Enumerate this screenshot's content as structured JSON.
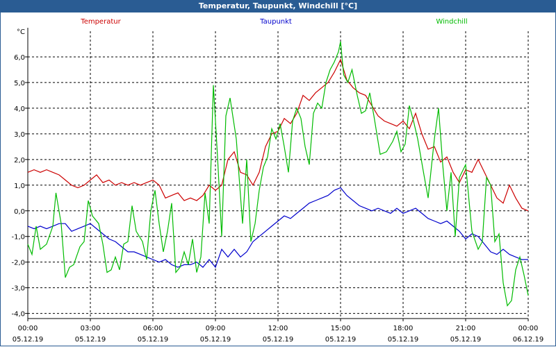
{
  "window": {
    "title": "Temperatur, Taupunkt, Windchill [°C]"
  },
  "colors": {
    "title_bar": "#2a5c93",
    "temperatur": "#cc0000",
    "taupunkt": "#0000cc",
    "windchill": "#00bb00",
    "grid": "#000000"
  },
  "chart_data": {
    "type": "line",
    "title": "Temperatur, Taupunkt, Windchill [°C]",
    "ylabel": "°C",
    "ylim": [
      -4.2,
      7.0
    ],
    "y_ticks": [
      -4.0,
      -3.0,
      -2.0,
      -1.0,
      0.0,
      1.0,
      2.0,
      3.0,
      4.0,
      5.0,
      6.0
    ],
    "y_tick_labels": [
      "-4,0",
      "-3,0",
      "-2,0",
      "-1,0",
      "0,0",
      "1,0",
      "2,0",
      "3,0",
      "4,0",
      "5,0",
      "6,0"
    ],
    "xlim": [
      0,
      24
    ],
    "x_ticks": [
      0,
      3,
      6,
      9,
      12,
      15,
      18,
      21,
      24
    ],
    "x_tick_times": [
      "00:00",
      "03:00",
      "06:00",
      "09:00",
      "12:00",
      "15:00",
      "18:00",
      "21:00",
      "00:00"
    ],
    "x_tick_dates": [
      "05.12.19",
      "05.12.19",
      "05.12.19",
      "05.12.19",
      "05.12.19",
      "05.12.19",
      "05.12.19",
      "05.12.19",
      "06.12.19"
    ],
    "grid": true,
    "legend_position": "top",
    "series": [
      {
        "name": "Temperatur",
        "color": "#cc0000",
        "points": [
          [
            0,
            1.5
          ],
          [
            0.3,
            1.6
          ],
          [
            0.6,
            1.5
          ],
          [
            0.9,
            1.6
          ],
          [
            1.2,
            1.5
          ],
          [
            1.5,
            1.4
          ],
          [
            1.8,
            1.2
          ],
          [
            2.1,
            1.0
          ],
          [
            2.4,
            0.9
          ],
          [
            2.7,
            1.0
          ],
          [
            3.0,
            1.2
          ],
          [
            3.3,
            1.4
          ],
          [
            3.6,
            1.1
          ],
          [
            3.9,
            1.2
          ],
          [
            4.2,
            1.0
          ],
          [
            4.5,
            1.1
          ],
          [
            4.8,
            1.0
          ],
          [
            5.1,
            1.1
          ],
          [
            5.4,
            1.0
          ],
          [
            5.7,
            1.1
          ],
          [
            6.0,
            1.2
          ],
          [
            6.3,
            1.0
          ],
          [
            6.6,
            0.5
          ],
          [
            6.9,
            0.6
          ],
          [
            7.2,
            0.7
          ],
          [
            7.5,
            0.4
          ],
          [
            7.8,
            0.5
          ],
          [
            8.1,
            0.4
          ],
          [
            8.4,
            0.6
          ],
          [
            8.7,
            1.0
          ],
          [
            9.0,
            0.8
          ],
          [
            9.3,
            1.0
          ],
          [
            9.6,
            2.0
          ],
          [
            9.9,
            2.3
          ],
          [
            10.2,
            1.5
          ],
          [
            10.5,
            1.4
          ],
          [
            10.8,
            1.0
          ],
          [
            11.1,
            1.5
          ],
          [
            11.4,
            2.5
          ],
          [
            11.7,
            3.0
          ],
          [
            12.0,
            3.1
          ],
          [
            12.3,
            3.6
          ],
          [
            12.6,
            3.4
          ],
          [
            12.9,
            3.8
          ],
          [
            13.2,
            4.5
          ],
          [
            13.5,
            4.3
          ],
          [
            13.8,
            4.6
          ],
          [
            14.1,
            4.8
          ],
          [
            14.4,
            5.0
          ],
          [
            14.7,
            5.4
          ],
          [
            15.0,
            5.9
          ],
          [
            15.3,
            5.1
          ],
          [
            15.6,
            4.8
          ],
          [
            15.9,
            4.6
          ],
          [
            16.2,
            4.5
          ],
          [
            16.5,
            4.1
          ],
          [
            16.8,
            3.7
          ],
          [
            17.1,
            3.5
          ],
          [
            17.4,
            3.4
          ],
          [
            17.7,
            3.3
          ],
          [
            18.0,
            3.5
          ],
          [
            18.3,
            3.2
          ],
          [
            18.6,
            3.8
          ],
          [
            18.9,
            3.0
          ],
          [
            19.2,
            2.4
          ],
          [
            19.5,
            2.5
          ],
          [
            19.8,
            1.9
          ],
          [
            20.1,
            2.1
          ],
          [
            20.4,
            1.5
          ],
          [
            20.7,
            1.1
          ],
          [
            21.0,
            1.6
          ],
          [
            21.3,
            1.5
          ],
          [
            21.6,
            2.0
          ],
          [
            21.9,
            1.5
          ],
          [
            22.2,
            1.0
          ],
          [
            22.5,
            0.5
          ],
          [
            22.8,
            0.3
          ],
          [
            23.1,
            1.0
          ],
          [
            23.4,
            0.5
          ],
          [
            23.7,
            0.1
          ],
          [
            24.0,
            0.0
          ]
        ]
      },
      {
        "name": "Taupunkt",
        "color": "#0000cc",
        "points": [
          [
            0,
            -0.6
          ],
          [
            0.3,
            -0.7
          ],
          [
            0.6,
            -0.6
          ],
          [
            0.9,
            -0.7
          ],
          [
            1.2,
            -0.6
          ],
          [
            1.5,
            -0.5
          ],
          [
            1.8,
            -0.5
          ],
          [
            2.1,
            -0.8
          ],
          [
            2.4,
            -0.7
          ],
          [
            2.7,
            -0.6
          ],
          [
            3.0,
            -0.5
          ],
          [
            3.3,
            -0.7
          ],
          [
            3.6,
            -0.9
          ],
          [
            3.9,
            -1.1
          ],
          [
            4.2,
            -1.2
          ],
          [
            4.5,
            -1.4
          ],
          [
            4.8,
            -1.6
          ],
          [
            5.1,
            -1.6
          ],
          [
            5.4,
            -1.7
          ],
          [
            5.7,
            -1.8
          ],
          [
            6.0,
            -1.9
          ],
          [
            6.3,
            -2.0
          ],
          [
            6.6,
            -1.9
          ],
          [
            6.9,
            -2.1
          ],
          [
            7.2,
            -2.2
          ],
          [
            7.5,
            -2.1
          ],
          [
            7.8,
            -2.1
          ],
          [
            8.1,
            -2.0
          ],
          [
            8.4,
            -2.2
          ],
          [
            8.7,
            -1.9
          ],
          [
            9.0,
            -2.2
          ],
          [
            9.3,
            -1.5
          ],
          [
            9.6,
            -1.8
          ],
          [
            9.9,
            -1.5
          ],
          [
            10.2,
            -1.8
          ],
          [
            10.5,
            -1.6
          ],
          [
            10.8,
            -1.2
          ],
          [
            11.1,
            -1.0
          ],
          [
            11.4,
            -0.8
          ],
          [
            11.7,
            -0.6
          ],
          [
            12.0,
            -0.4
          ],
          [
            12.3,
            -0.2
          ],
          [
            12.6,
            -0.3
          ],
          [
            12.9,
            -0.1
          ],
          [
            13.2,
            0.1
          ],
          [
            13.5,
            0.3
          ],
          [
            13.8,
            0.4
          ],
          [
            14.1,
            0.5
          ],
          [
            14.4,
            0.6
          ],
          [
            14.7,
            0.8
          ],
          [
            15.0,
            0.9
          ],
          [
            15.3,
            0.6
          ],
          [
            15.6,
            0.4
          ],
          [
            15.9,
            0.2
          ],
          [
            16.2,
            0.1
          ],
          [
            16.5,
            0.0
          ],
          [
            16.8,
            0.1
          ],
          [
            17.1,
            0.0
          ],
          [
            17.4,
            -0.1
          ],
          [
            17.7,
            0.1
          ],
          [
            18.0,
            -0.1
          ],
          [
            18.3,
            0.0
          ],
          [
            18.6,
            0.1
          ],
          [
            18.9,
            -0.1
          ],
          [
            19.2,
            -0.3
          ],
          [
            19.5,
            -0.4
          ],
          [
            19.8,
            -0.5
          ],
          [
            20.1,
            -0.4
          ],
          [
            20.4,
            -0.6
          ],
          [
            20.7,
            -0.8
          ],
          [
            21.0,
            -1.1
          ],
          [
            21.3,
            -0.9
          ],
          [
            21.6,
            -1.0
          ],
          [
            21.9,
            -1.3
          ],
          [
            22.2,
            -1.6
          ],
          [
            22.5,
            -1.7
          ],
          [
            22.8,
            -1.5
          ],
          [
            23.1,
            -1.7
          ],
          [
            23.4,
            -1.8
          ],
          [
            23.7,
            -1.9
          ],
          [
            24.0,
            -1.9
          ]
        ]
      },
      {
        "name": "Windchill",
        "color": "#00bb00",
        "points": [
          [
            0,
            -1.3
          ],
          [
            0.2,
            -1.7
          ],
          [
            0.4,
            -0.6
          ],
          [
            0.6,
            -1.5
          ],
          [
            0.9,
            -1.3
          ],
          [
            1.2,
            -0.6
          ],
          [
            1.35,
            0.7
          ],
          [
            1.6,
            -0.5
          ],
          [
            1.8,
            -2.6
          ],
          [
            2.0,
            -2.2
          ],
          [
            2.2,
            -2.1
          ],
          [
            2.5,
            -1.4
          ],
          [
            2.7,
            -1.2
          ],
          [
            2.9,
            0.4
          ],
          [
            3.1,
            -0.2
          ],
          [
            3.4,
            -0.5
          ],
          [
            3.6,
            -1.3
          ],
          [
            3.8,
            -2.4
          ],
          [
            4.0,
            -2.3
          ],
          [
            4.2,
            -1.8
          ],
          [
            4.4,
            -2.3
          ],
          [
            4.6,
            -1.3
          ],
          [
            4.8,
            -1.2
          ],
          [
            5.0,
            0.2
          ],
          [
            5.2,
            -0.8
          ],
          [
            5.5,
            -1.2
          ],
          [
            5.7,
            -1.9
          ],
          [
            5.9,
            0.0
          ],
          [
            6.1,
            0.8
          ],
          [
            6.3,
            -0.5
          ],
          [
            6.5,
            -1.6
          ],
          [
            6.7,
            -0.8
          ],
          [
            6.9,
            0.3
          ],
          [
            7.1,
            -2.4
          ],
          [
            7.3,
            -2.2
          ],
          [
            7.5,
            -1.6
          ],
          [
            7.7,
            -2.1
          ],
          [
            7.9,
            -1.1
          ],
          [
            8.1,
            -2.4
          ],
          [
            8.3,
            -1.8
          ],
          [
            8.5,
            0.7
          ],
          [
            8.7,
            -0.5
          ],
          [
            8.9,
            4.9
          ],
          [
            9.1,
            2.1
          ],
          [
            9.3,
            -1.0
          ],
          [
            9.5,
            3.7
          ],
          [
            9.7,
            4.4
          ],
          [
            10.0,
            2.8
          ],
          [
            10.3,
            -0.5
          ],
          [
            10.5,
            2.0
          ],
          [
            10.7,
            -1.2
          ],
          [
            10.9,
            -0.5
          ],
          [
            11.1,
            0.8
          ],
          [
            11.3,
            1.7
          ],
          [
            11.5,
            2.1
          ],
          [
            11.7,
            3.2
          ],
          [
            11.9,
            2.8
          ],
          [
            12.1,
            3.4
          ],
          [
            12.3,
            2.5
          ],
          [
            12.5,
            1.5
          ],
          [
            12.7,
            3.5
          ],
          [
            12.9,
            4.0
          ],
          [
            13.1,
            3.6
          ],
          [
            13.3,
            2.5
          ],
          [
            13.5,
            1.8
          ],
          [
            13.7,
            3.8
          ],
          [
            13.9,
            4.2
          ],
          [
            14.1,
            4.0
          ],
          [
            14.3,
            5.0
          ],
          [
            14.5,
            5.5
          ],
          [
            14.7,
            5.8
          ],
          [
            14.9,
            6.2
          ],
          [
            15.0,
            6.6
          ],
          [
            15.15,
            5.3
          ],
          [
            15.35,
            5.0
          ],
          [
            15.55,
            5.5
          ],
          [
            15.8,
            4.5
          ],
          [
            16.0,
            3.8
          ],
          [
            16.2,
            3.9
          ],
          [
            16.4,
            4.6
          ],
          [
            16.6,
            3.7
          ],
          [
            16.9,
            2.2
          ],
          [
            17.2,
            2.3
          ],
          [
            17.5,
            2.7
          ],
          [
            17.7,
            3.1
          ],
          [
            17.9,
            2.3
          ],
          [
            18.1,
            2.6
          ],
          [
            18.3,
            4.1
          ],
          [
            18.5,
            3.5
          ],
          [
            18.7,
            2.8
          ],
          [
            19.0,
            1.4
          ],
          [
            19.2,
            0.5
          ],
          [
            19.5,
            2.8
          ],
          [
            19.7,
            4.0
          ],
          [
            19.9,
            1.8
          ],
          [
            20.1,
            0.0
          ],
          [
            20.3,
            1.5
          ],
          [
            20.5,
            -1.0
          ],
          [
            20.7,
            1.3
          ],
          [
            21.0,
            1.8
          ],
          [
            21.3,
            -0.8
          ],
          [
            21.6,
            -1.5
          ],
          [
            21.8,
            -1.2
          ],
          [
            22.0,
            1.3
          ],
          [
            22.2,
            1.0
          ],
          [
            22.4,
            -1.2
          ],
          [
            22.6,
            -0.9
          ],
          [
            22.8,
            -2.8
          ],
          [
            23.0,
            -3.7
          ],
          [
            23.2,
            -3.5
          ],
          [
            23.4,
            -2.3
          ],
          [
            23.6,
            -1.8
          ],
          [
            23.8,
            -2.5
          ],
          [
            24.0,
            -3.3
          ]
        ]
      }
    ]
  }
}
